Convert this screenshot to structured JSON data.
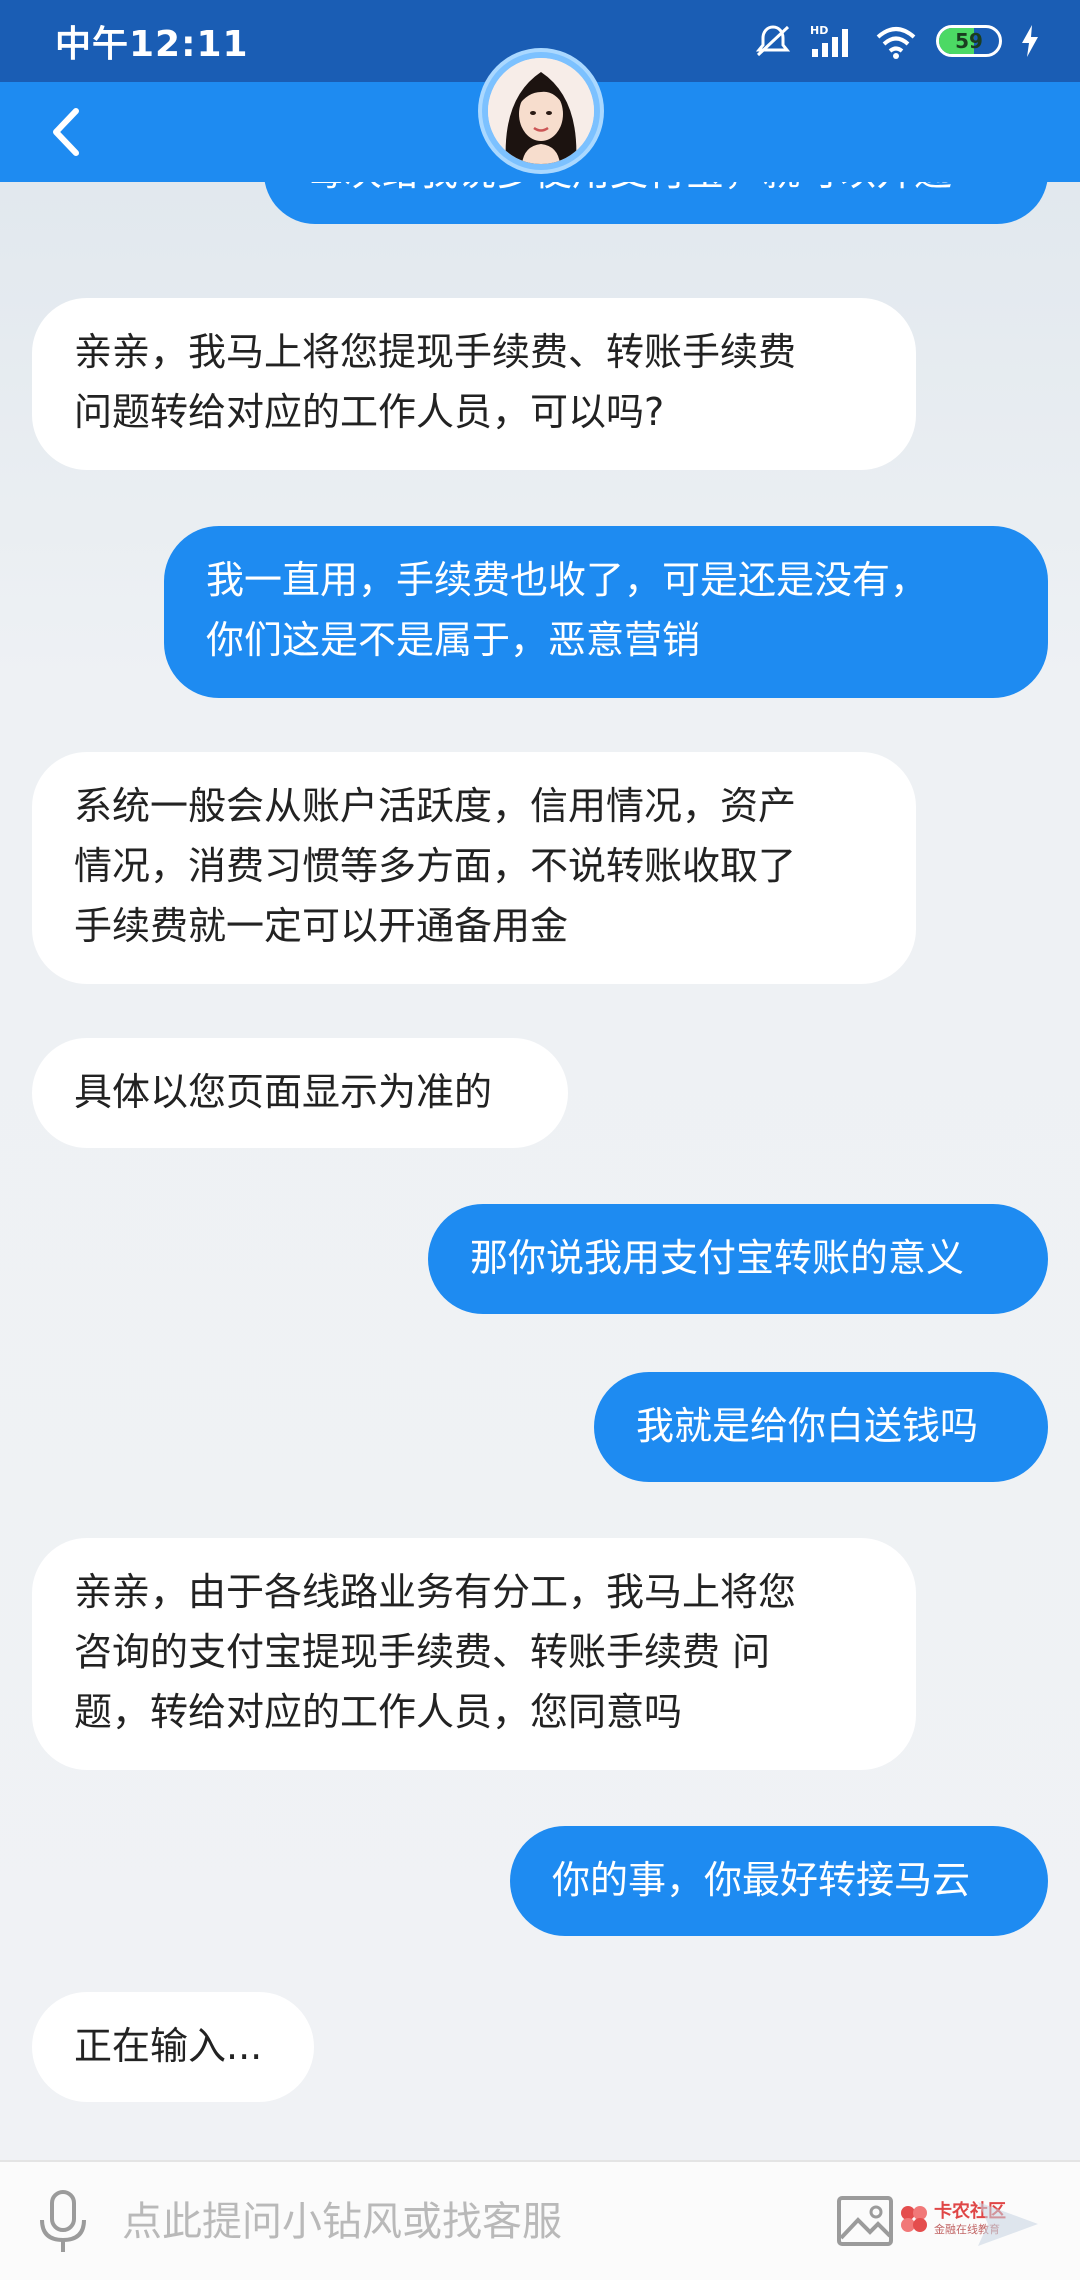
{
  "status_bar": {
    "time": "中午12:11",
    "hd_label": "HD",
    "battery_level": "59"
  },
  "messages": [
    {
      "from": "me",
      "text": "每次给我说多使用支付宝，就可以开通"
    },
    {
      "from": "bot",
      "text": "亲亲，我马上将您提现手续费、转账手续费\n问题转给对应的工作人员，可以吗?"
    },
    {
      "from": "me",
      "text": "我一直用，手续费也收了，可是还是没有，\n你们这是不是属于，恶意营销"
    },
    {
      "from": "bot",
      "text": "系统一般会从账户活跃度，信用情况，资产\n情况，消费习惯等多方面，不说转账收取了\n手续费就一定可以开通备用金"
    },
    {
      "from": "bot",
      "text": "具体以您页面显示为准的"
    },
    {
      "from": "me",
      "text": "那你说我用支付宝转账的意义"
    },
    {
      "from": "me",
      "text": "我就是给你白送钱吗"
    },
    {
      "from": "bot",
      "text": "亲亲，由于各线路业务有分工，我马上将您\n咨询的支付宝提现手续费、转账手续费 问\n题，转给对应的工作人员，您同意吗"
    },
    {
      "from": "me",
      "text": "你的事，你最好转接马云"
    },
    {
      "from": "bot",
      "text": "正在输入..."
    }
  ],
  "input_bar": {
    "placeholder": "点此提问小钻风或找客服"
  },
  "watermark": {
    "main": "卡农社区",
    "sub": "金融在线教育"
  },
  "colors": {
    "status_bar": "#1a5db4",
    "header": "#1e8bf1",
    "my_bubble": "#1e8bf1",
    "bot_bubble": "#ffffff"
  }
}
